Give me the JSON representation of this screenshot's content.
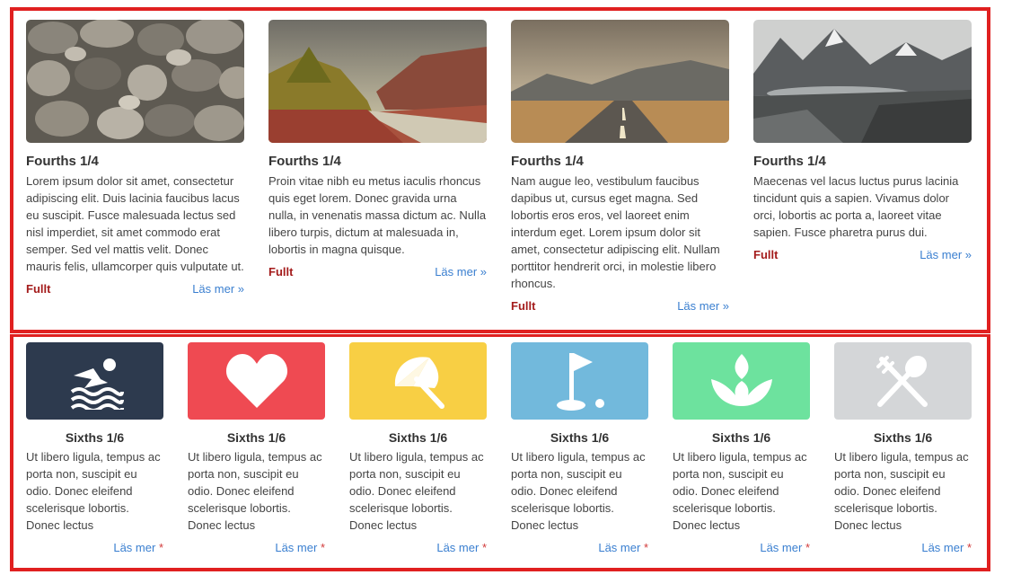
{
  "fourths": [
    {
      "title": "Fourths 1/4",
      "text": "Lorem ipsum dolor sit amet, consectetur adipiscing elit. Duis lacinia faucibus lacus eu suscipit. Fusce malesuada lectus sed nisl imperdiet, sit amet commodo erat semper. Sed vel mattis velit. Donec mauris felis, ullamcorper quis vulputate ut.",
      "tag": "Fullt",
      "link": "Läs mer »"
    },
    {
      "title": "Fourths 1/4",
      "text": "Proin vitae nibh eu metus iaculis rhoncus quis eget lorem. Donec gravida urna nulla, in venenatis massa dictum ac. Nulla libero turpis, dictum at malesuada in, lobortis in magna quisque.",
      "tag": "Fullt",
      "link": "Läs mer »"
    },
    {
      "title": "Fourths 1/4",
      "text": "Nam augue leo, vestibulum faucibus dapibus ut, cursus eget magna. Sed lobortis eros eros, vel laoreet enim interdum eget. Lorem ipsum dolor sit amet, consectetur adipiscing elit. Nullam porttitor hendrerit orci, in molestie libero rhoncus.",
      "tag": "Fullt",
      "link": "Läs mer »"
    },
    {
      "title": "Fourths 1/4",
      "text": "Maecenas vel lacus luctus purus lacinia tincidunt quis a sapien. Vivamus dolor orci, lobortis ac porta a, laoreet vitae sapien. Fusce pharetra purus dui.",
      "tag": "Fullt",
      "link": "Läs mer »"
    }
  ],
  "sixths": [
    {
      "title": "Sixths 1/6",
      "text": "Ut libero ligula, tempus ac porta non, suscipit eu odio. Donec eleifend scelerisque lobortis. Donec lectus",
      "link": "Läs mer",
      "mark": "*",
      "icon": "swimming-icon",
      "color": "#2d3a4e"
    },
    {
      "title": "Sixths 1/6",
      "text": "Ut libero ligula, tempus ac porta non, suscipit eu odio. Donec eleifend scelerisque lobortis. Donec lectus",
      "link": "Läs mer",
      "mark": "*",
      "icon": "heart-icon",
      "color": "#ef4a52"
    },
    {
      "title": "Sixths 1/6",
      "text": "Ut libero ligula, tempus ac porta non, suscipit eu odio. Donec eleifend scelerisque lobortis. Donec lectus",
      "link": "Läs mer",
      "mark": "*",
      "icon": "umbrella-icon",
      "color": "#f8cf44"
    },
    {
      "title": "Sixths 1/6",
      "text": "Ut libero ligula, tempus ac porta non, suscipit eu odio. Donec eleifend scelerisque lobortis. Donec lectus",
      "link": "Läs mer",
      "mark": "*",
      "icon": "golf-flag-icon",
      "color": "#72b9dc"
    },
    {
      "title": "Sixths 1/6",
      "text": "Ut libero ligula, tempus ac porta non, suscipit eu odio. Donec eleifend scelerisque lobortis. Donec lectus",
      "link": "Läs mer",
      "mark": "*",
      "icon": "lotus-icon",
      "color": "#6de29e"
    },
    {
      "title": "Sixths 1/6",
      "text": "Ut libero ligula, tempus ac porta non, suscipit eu odio. Donec eleifend scelerisque lobortis. Donec lectus",
      "link": "Läs mer",
      "mark": "*",
      "icon": "fork-spoon-icon",
      "color": "#d4d6d8"
    }
  ]
}
